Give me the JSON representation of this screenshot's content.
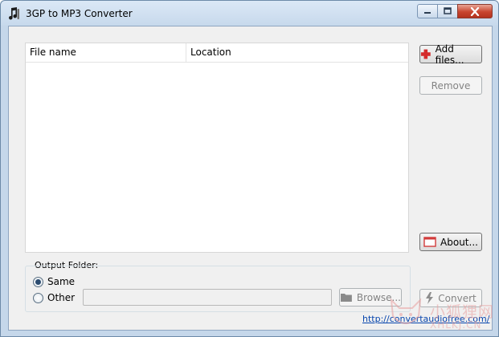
{
  "window": {
    "title": "3GP to MP3 Converter"
  },
  "listview": {
    "columns": [
      "File name",
      "Location"
    ]
  },
  "buttons": {
    "add_files": "Add files...",
    "remove": "Remove",
    "about": "About...",
    "convert": "Convert",
    "browse": "Browse..."
  },
  "output": {
    "legend": "Output Folder:",
    "same_label": "Same",
    "other_label": "Other",
    "selected": "Same",
    "path_value": ""
  },
  "footer": {
    "link": "http://convertaudiofree.com/"
  },
  "watermark": {
    "text": "小狐狸网",
    "url": "XHLKJ.CN"
  },
  "colors": {
    "titlebar": "#c7d9ec",
    "close": "#c8452f",
    "link": "#0645ad"
  },
  "icons": {
    "app": "music-note-icon",
    "add": "plus-icon",
    "about": "window-icon",
    "convert": "lightning-icon",
    "browse": "folder-icon"
  }
}
